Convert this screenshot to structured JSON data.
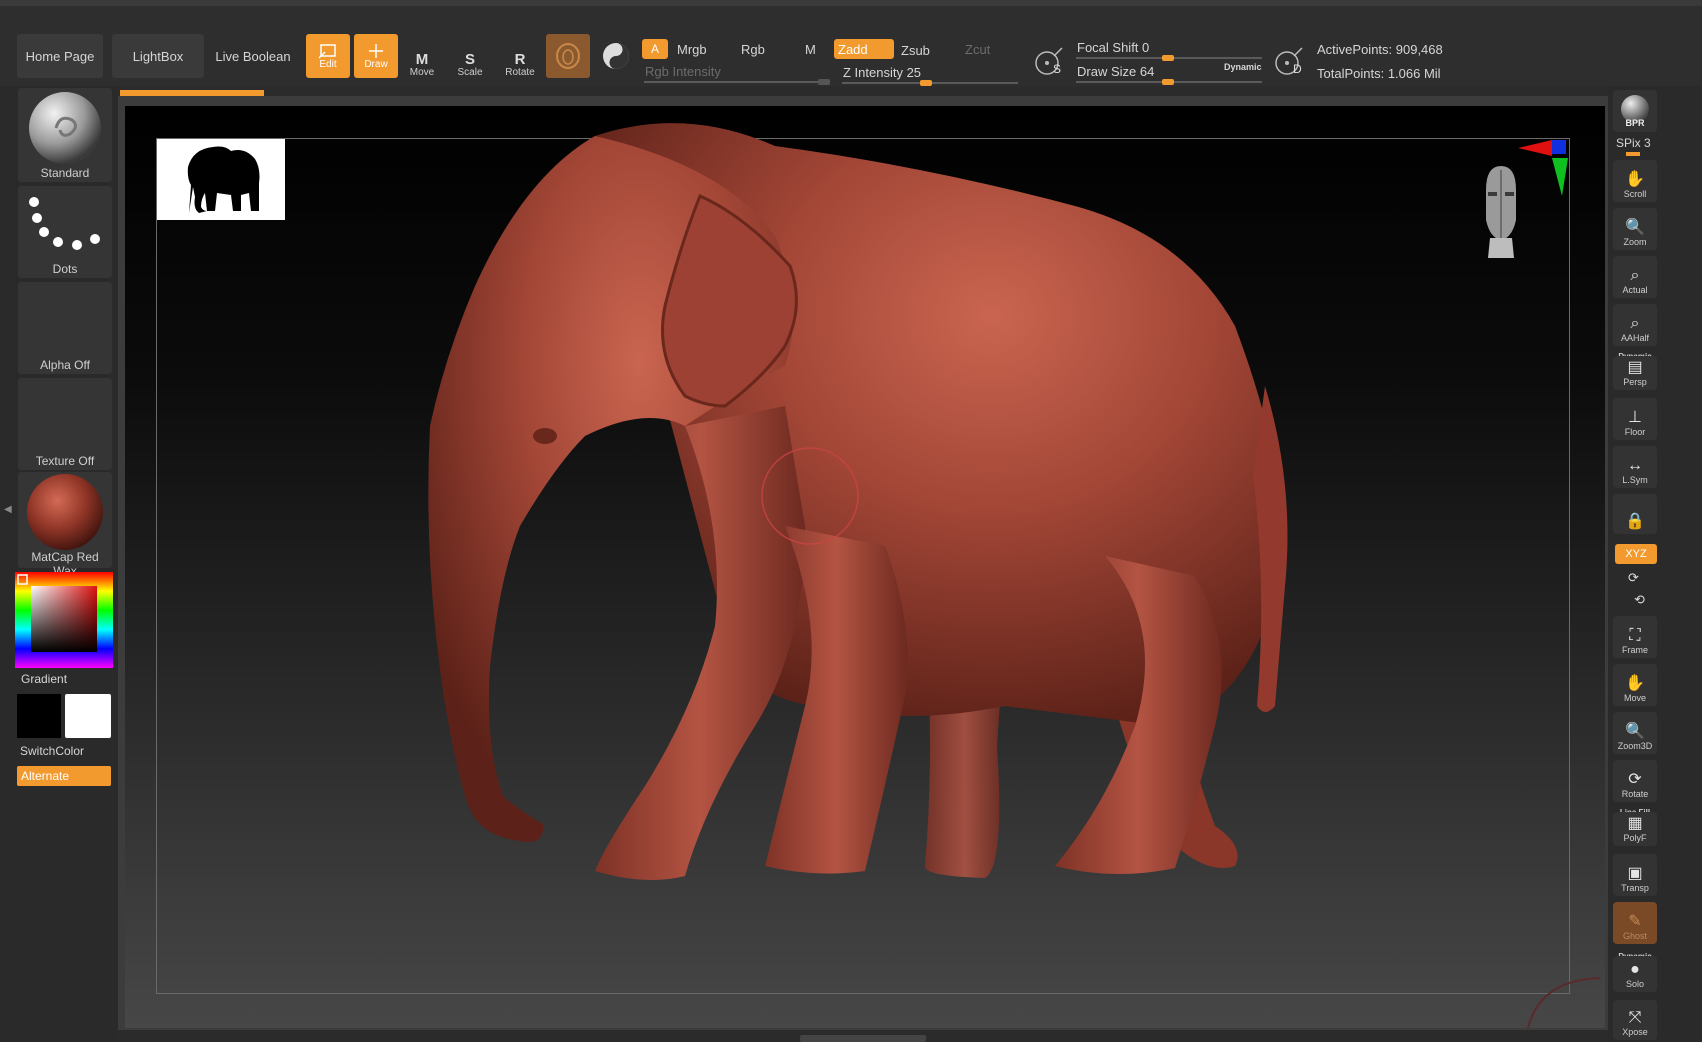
{
  "toolbar": {
    "home_page": "Home Page",
    "lightbox": "LightBox",
    "live_boolean": "Live Boolean",
    "edit": "Edit",
    "draw": "Draw",
    "move": "Move",
    "scale": "Scale",
    "rotate": "Rotate",
    "move_glyph": "M",
    "scale_glyph": "S",
    "rotate_glyph": "R",
    "a": "A",
    "mrgb": "Mrgb",
    "rgb": "Rgb",
    "m": "M",
    "rgb_intensity": "Rgb Intensity",
    "zadd": "Zadd",
    "zsub": "Zsub",
    "zcut": "Zcut",
    "z_intensity": "Z Intensity 25",
    "z_intensity_value": 25,
    "focal_shift": "Focal Shift 0",
    "focal_shift_value": 0,
    "draw_size": "Draw Size 64",
    "draw_size_value": 64,
    "dynamic": "Dynamic",
    "s_label": "S",
    "d_label": "D",
    "active_points": "ActivePoints: 909,468",
    "total_points": "TotalPoints: 1.066 Mil"
  },
  "left_tray": {
    "brush": "Standard",
    "stroke": "Dots",
    "alpha": "Alpha Off",
    "texture": "Texture Off",
    "material": "MatCap Red Wax",
    "gradient": "Gradient",
    "switch_color": "SwitchColor",
    "alternate": "Alternate"
  },
  "right_tray": {
    "bpr": "BPR",
    "spix": "SPix 3",
    "spix_value": 3,
    "buttons": {
      "scroll": "Scroll",
      "zoom": "Zoom",
      "actual": "Actual",
      "aahalf": "AAHalf",
      "persp_top": "Dynamic",
      "persp": "Persp",
      "floor": "Floor",
      "lsym": "L.Sym",
      "xyz": "XYZ",
      "frame": "Frame",
      "move": "Move",
      "zoom3d": "Zoom3D",
      "rotate": "Rotate",
      "polyf_top": "Line Fill",
      "polyf": "PolyF",
      "transp": "Transp",
      "ghost": "Ghost",
      "solo_top": "Dynamic",
      "solo": "Solo",
      "xpose": "Xpose"
    }
  },
  "colors": {
    "accent": "#f39a2e",
    "model": "#a3453a",
    "background": "#2b2b2b"
  },
  "icons": [
    "elephant-reference-icon",
    "navigation-head-icon",
    "axis-gizmo-icon",
    "brush-cursor-icon"
  ]
}
